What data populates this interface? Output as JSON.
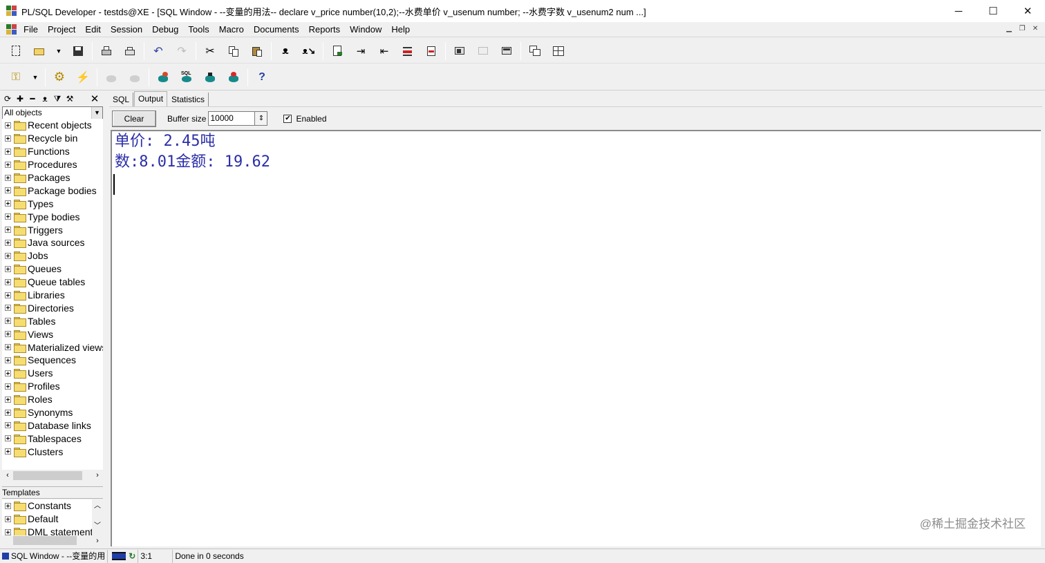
{
  "window": {
    "title": "PL/SQL Developer - testds@XE - [SQL Window - --变量的用法-- declare v_price number(10,2);--水费单价 v_usenum number; --水费字数 v_usenum2 num ...]",
    "controls": {
      "minimize": "─",
      "maximize": "☐",
      "close": "✕"
    }
  },
  "menu": [
    "File",
    "Project",
    "Edit",
    "Session",
    "Debug",
    "Tools",
    "Macro",
    "Documents",
    "Reports",
    "Window",
    "Help"
  ],
  "left_panel": {
    "combo_value": "All objects",
    "tree": [
      "Recent objects",
      "Recycle bin",
      "Functions",
      "Procedures",
      "Packages",
      "Package bodies",
      "Types",
      "Type bodies",
      "Triggers",
      "Java sources",
      "Jobs",
      "Queues",
      "Queue tables",
      "Libraries",
      "Directories",
      "Tables",
      "Views",
      "Materialized views",
      "Sequences",
      "Users",
      "Profiles",
      "Roles",
      "Synonyms",
      "Database links",
      "Tablespaces",
      "Clusters"
    ],
    "templates_label": "Templates",
    "templates": [
      "Constants",
      "Default",
      "DML statements"
    ]
  },
  "tabs": [
    "SQL",
    "Output",
    "Statistics"
  ],
  "active_tab": "Output",
  "output_toolbar": {
    "clear_label": "Clear",
    "buffer_label": "Buffer size",
    "buffer_value": "10000",
    "enabled_label": "Enabled",
    "enabled_checked": true
  },
  "output_lines": [
    "单价: 2.45吨",
    "数:8.01金额: 19.62"
  ],
  "watermark": "@稀土掘金技术社区",
  "status": {
    "window_label": "SQL Window - --变量的用",
    "position": "3:1",
    "message": "Done in 0 seconds"
  },
  "colors": {
    "output_text": "#2b2ea8"
  }
}
